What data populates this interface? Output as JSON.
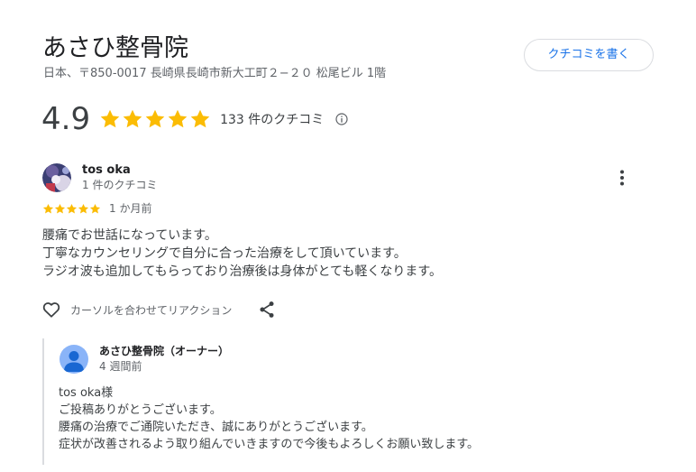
{
  "business": {
    "name": "あさひ整骨院",
    "address": "日本、〒850-0017 長崎県長崎市新大工町２−２０ 松尾ビル 1階",
    "write_review_label": "クチコミを書く"
  },
  "rating": {
    "score": "4.9",
    "stars": 5,
    "review_count_label": "133 件のクチコミ",
    "star_color": "#fbbc04"
  },
  "review": {
    "author": "tos oka",
    "author_meta": "1 件のクチコミ",
    "stars": 5,
    "date": "1 か月前",
    "text_lines": [
      "腰痛でお世話になっています。",
      "丁寧なカウンセリングで自分に合った治療をして頂いています。",
      "ラジオ波も追加してもらっており治療後は身体がとても軽くなります。"
    ],
    "reaction_label": "カーソルを合わせてリアクション"
  },
  "owner_reply": {
    "name": "あさひ整骨院（オーナー）",
    "date": "4 週間前",
    "text_lines": [
      "tos oka様",
      "ご投稿ありがとうございます。",
      "腰痛の治療でご通院いただき、誠にありがとうございます。",
      "症状が改善されるよう取り組んでいきますので今後もよろしくお願い致します。"
    ]
  },
  "icons": {
    "star": "star-icon",
    "info": "info-icon",
    "more": "more-vert-icon",
    "heart": "heart-icon",
    "share": "share-icon",
    "avatar": "person-icon"
  },
  "colors": {
    "accent": "#1a73e8",
    "star": "#fbbc04",
    "owner_avatar": "#8ab4f8",
    "text_secondary": "#5f6368"
  }
}
